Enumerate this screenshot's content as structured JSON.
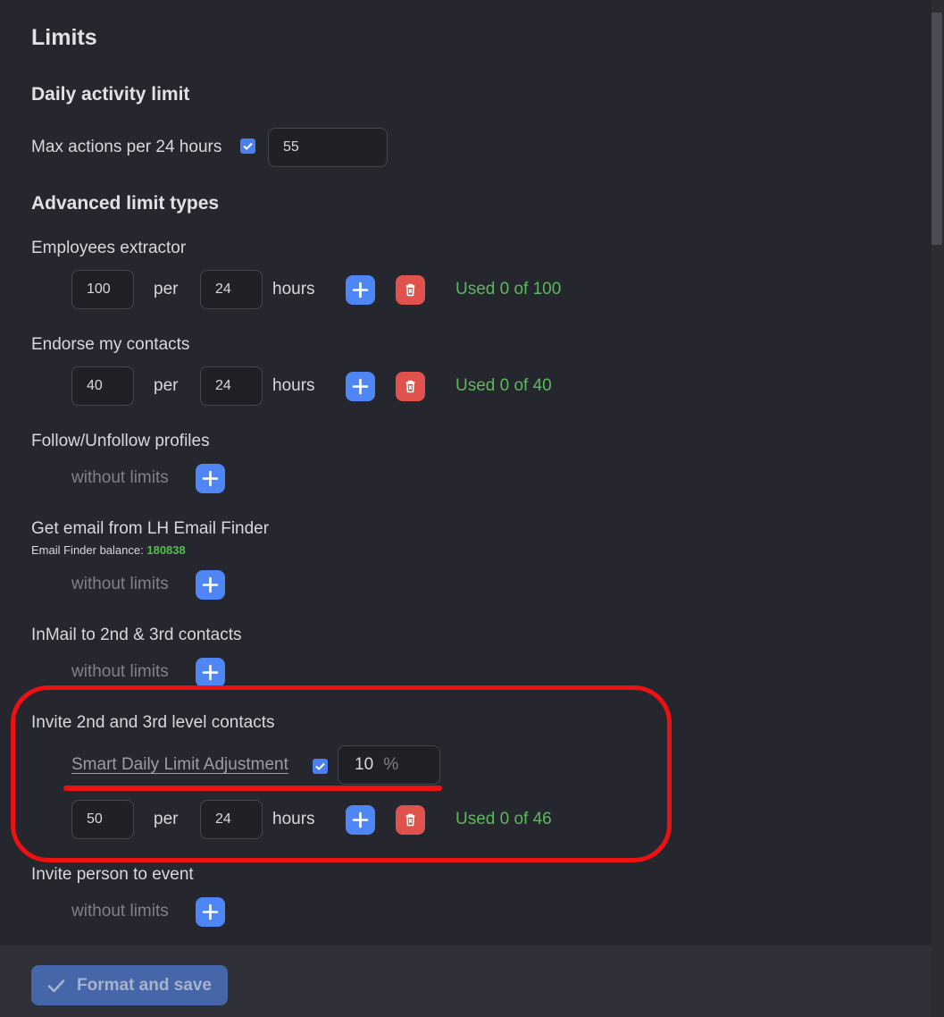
{
  "page_title": "Limits",
  "daily": {
    "heading": "Daily activity limit",
    "max_label": "Max actions per 24 hours",
    "max_value": "55",
    "max_checked": true
  },
  "advanced": {
    "heading": "Advanced limit types",
    "common": {
      "per": "per",
      "hours": "hours",
      "without": "without limits"
    },
    "employees": {
      "title": "Employees extractor",
      "count": "100",
      "period": "24",
      "used": "Used 0 of 100"
    },
    "endorse": {
      "title": "Endorse my contacts",
      "count": "40",
      "period": "24",
      "used": "Used 0 of 40"
    },
    "follow": {
      "title": "Follow/Unfollow profiles"
    },
    "email": {
      "title": "Get email from LH Email Finder",
      "balance_label": "Email Finder balance:",
      "balance_value": "180838"
    },
    "inmail": {
      "title": "InMail to 2nd & 3rd contacts"
    },
    "invite": {
      "title": "Invite 2nd and 3rd level contacts",
      "smart_label": "Smart Daily Limit Adjustment",
      "smart_checked": true,
      "smart_value": "10",
      "smart_unit": "%",
      "count": "50",
      "period": "24",
      "used": "Used 0 of 46"
    },
    "event": {
      "title": "Invite person to event"
    }
  },
  "footer": {
    "save_label": "Format and save"
  },
  "colors": {
    "accent": "#4f86f5",
    "danger": "#e0524c",
    "success": "#5cb85c",
    "annotation": "#ee1111"
  },
  "icons": {
    "add": "plus-icon",
    "delete": "trash-icon",
    "save": "check-icon"
  }
}
